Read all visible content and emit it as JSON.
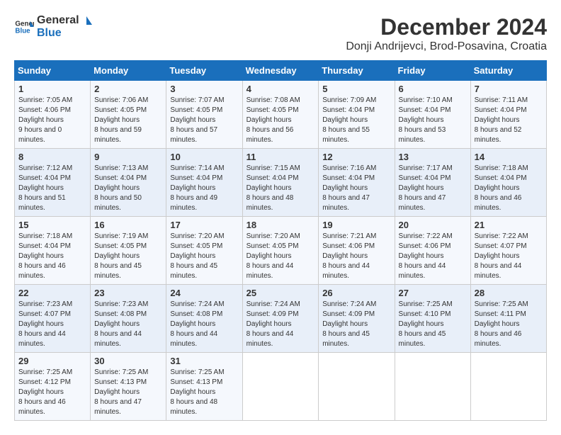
{
  "logo": {
    "line1": "General",
    "line2": "Blue"
  },
  "title": "December 2024",
  "location": "Donji Andrijevci, Brod-Posavina, Croatia",
  "days_of_week": [
    "Sunday",
    "Monday",
    "Tuesday",
    "Wednesday",
    "Thursday",
    "Friday",
    "Saturday"
  ],
  "weeks": [
    [
      {
        "day": "1",
        "sunrise": "7:05 AM",
        "sunset": "4:06 PM",
        "daylight": "9 hours and 0 minutes"
      },
      {
        "day": "2",
        "sunrise": "7:06 AM",
        "sunset": "4:05 PM",
        "daylight": "8 hours and 59 minutes"
      },
      {
        "day": "3",
        "sunrise": "7:07 AM",
        "sunset": "4:05 PM",
        "daylight": "8 hours and 57 minutes"
      },
      {
        "day": "4",
        "sunrise": "7:08 AM",
        "sunset": "4:05 PM",
        "daylight": "8 hours and 56 minutes"
      },
      {
        "day": "5",
        "sunrise": "7:09 AM",
        "sunset": "4:04 PM",
        "daylight": "8 hours and 55 minutes"
      },
      {
        "day": "6",
        "sunrise": "7:10 AM",
        "sunset": "4:04 PM",
        "daylight": "8 hours and 53 minutes"
      },
      {
        "day": "7",
        "sunrise": "7:11 AM",
        "sunset": "4:04 PM",
        "daylight": "8 hours and 52 minutes"
      }
    ],
    [
      {
        "day": "8",
        "sunrise": "7:12 AM",
        "sunset": "4:04 PM",
        "daylight": "8 hours and 51 minutes"
      },
      {
        "day": "9",
        "sunrise": "7:13 AM",
        "sunset": "4:04 PM",
        "daylight": "8 hours and 50 minutes"
      },
      {
        "day": "10",
        "sunrise": "7:14 AM",
        "sunset": "4:04 PM",
        "daylight": "8 hours and 49 minutes"
      },
      {
        "day": "11",
        "sunrise": "7:15 AM",
        "sunset": "4:04 PM",
        "daylight": "8 hours and 48 minutes"
      },
      {
        "day": "12",
        "sunrise": "7:16 AM",
        "sunset": "4:04 PM",
        "daylight": "8 hours and 47 minutes"
      },
      {
        "day": "13",
        "sunrise": "7:17 AM",
        "sunset": "4:04 PM",
        "daylight": "8 hours and 47 minutes"
      },
      {
        "day": "14",
        "sunrise": "7:18 AM",
        "sunset": "4:04 PM",
        "daylight": "8 hours and 46 minutes"
      }
    ],
    [
      {
        "day": "15",
        "sunrise": "7:18 AM",
        "sunset": "4:04 PM",
        "daylight": "8 hours and 46 minutes"
      },
      {
        "day": "16",
        "sunrise": "7:19 AM",
        "sunset": "4:05 PM",
        "daylight": "8 hours and 45 minutes"
      },
      {
        "day": "17",
        "sunrise": "7:20 AM",
        "sunset": "4:05 PM",
        "daylight": "8 hours and 45 minutes"
      },
      {
        "day": "18",
        "sunrise": "7:20 AM",
        "sunset": "4:05 PM",
        "daylight": "8 hours and 44 minutes"
      },
      {
        "day": "19",
        "sunrise": "7:21 AM",
        "sunset": "4:06 PM",
        "daylight": "8 hours and 44 minutes"
      },
      {
        "day": "20",
        "sunrise": "7:22 AM",
        "sunset": "4:06 PM",
        "daylight": "8 hours and 44 minutes"
      },
      {
        "day": "21",
        "sunrise": "7:22 AM",
        "sunset": "4:07 PM",
        "daylight": "8 hours and 44 minutes"
      }
    ],
    [
      {
        "day": "22",
        "sunrise": "7:23 AM",
        "sunset": "4:07 PM",
        "daylight": "8 hours and 44 minutes"
      },
      {
        "day": "23",
        "sunrise": "7:23 AM",
        "sunset": "4:08 PM",
        "daylight": "8 hours and 44 minutes"
      },
      {
        "day": "24",
        "sunrise": "7:24 AM",
        "sunset": "4:08 PM",
        "daylight": "8 hours and 44 minutes"
      },
      {
        "day": "25",
        "sunrise": "7:24 AM",
        "sunset": "4:09 PM",
        "daylight": "8 hours and 44 minutes"
      },
      {
        "day": "26",
        "sunrise": "7:24 AM",
        "sunset": "4:09 PM",
        "daylight": "8 hours and 45 minutes"
      },
      {
        "day": "27",
        "sunrise": "7:25 AM",
        "sunset": "4:10 PM",
        "daylight": "8 hours and 45 minutes"
      },
      {
        "day": "28",
        "sunrise": "7:25 AM",
        "sunset": "4:11 PM",
        "daylight": "8 hours and 46 minutes"
      }
    ],
    [
      {
        "day": "29",
        "sunrise": "7:25 AM",
        "sunset": "4:12 PM",
        "daylight": "8 hours and 46 minutes"
      },
      {
        "day": "30",
        "sunrise": "7:25 AM",
        "sunset": "4:13 PM",
        "daylight": "8 hours and 47 minutes"
      },
      {
        "day": "31",
        "sunrise": "7:25 AM",
        "sunset": "4:13 PM",
        "daylight": "8 hours and 48 minutes"
      },
      null,
      null,
      null,
      null
    ]
  ],
  "labels": {
    "sunrise": "Sunrise:",
    "sunset": "Sunset:",
    "daylight": "Daylight hours"
  }
}
